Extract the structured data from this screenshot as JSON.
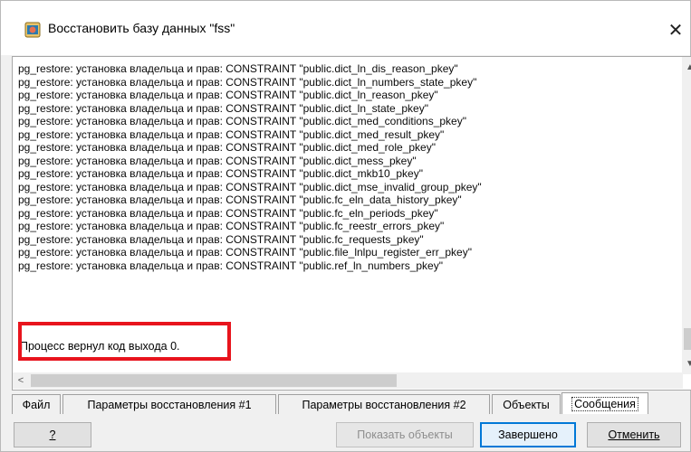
{
  "window": {
    "title": "Восстановить базу данных \"fss\"",
    "close_glyph": "✕"
  },
  "log": {
    "lines": [
      "pg_restore: установка владельца и прав: CONSTRAINT \"public.dict_ln_dis_reason_pkey\"",
      "pg_restore: установка владельца и прав: CONSTRAINT \"public.dict_ln_numbers_state_pkey\"",
      "pg_restore: установка владельца и прав: CONSTRAINT \"public.dict_ln_reason_pkey\"",
      "pg_restore: установка владельца и прав: CONSTRAINT \"public.dict_ln_state_pkey\"",
      "pg_restore: установка владельца и прав: CONSTRAINT \"public.dict_med_conditions_pkey\"",
      "pg_restore: установка владельца и прав: CONSTRAINT \"public.dict_med_result_pkey\"",
      "pg_restore: установка владельца и прав: CONSTRAINT \"public.dict_med_role_pkey\"",
      "pg_restore: установка владельца и прав: CONSTRAINT \"public.dict_mess_pkey\"",
      "pg_restore: установка владельца и прав: CONSTRAINT \"public.dict_mkb10_pkey\"",
      "pg_restore: установка владельца и прав: CONSTRAINT \"public.dict_mse_invalid_group_pkey\"",
      "pg_restore: установка владельца и прав: CONSTRAINT \"public.fc_eln_data_history_pkey\"",
      "pg_restore: установка владельца и прав: CONSTRAINT \"public.fc_eln_periods_pkey\"",
      "pg_restore: установка владельца и прав: CONSTRAINT \"public.fc_reestr_errors_pkey\"",
      "pg_restore: установка владельца и прав: CONSTRAINT \"public.fc_requests_pkey\"",
      "pg_restore: установка владельца и прав: CONSTRAINT \"public.file_lnlpu_register_err_pkey\"",
      "pg_restore: установка владельца и прав: CONSTRAINT \"public.ref_ln_numbers_pkey\""
    ],
    "result": "Процесс вернул код выхода 0."
  },
  "scrollbars": {
    "up": "▲",
    "down": "▼",
    "left": "<"
  },
  "tabs": [
    {
      "label": "Файл"
    },
    {
      "label": "Параметры восстановления #1"
    },
    {
      "label": "Параметры восстановления #2"
    },
    {
      "label": "Объекты"
    },
    {
      "label": "Сообщения"
    }
  ],
  "buttons": {
    "help": "?",
    "show_objects": "Показать объекты",
    "done": "Завершено",
    "cancel": "Отменить"
  },
  "colors": {
    "highlight": "#e8141d",
    "default_button_border": "#0078d7"
  }
}
